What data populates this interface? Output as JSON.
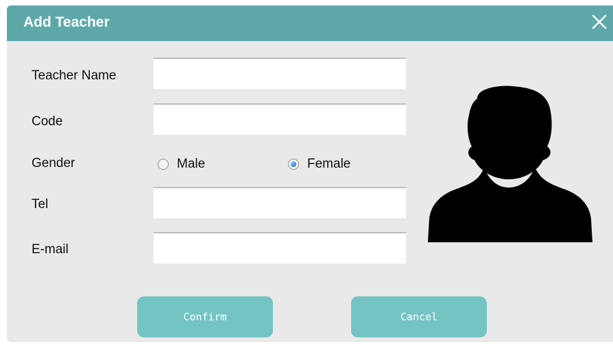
{
  "dialog": {
    "title": "Add Teacher",
    "accent_color": "#5ea8aa",
    "button_color": "#74c4c4"
  },
  "form": {
    "name_label": "Teacher Name",
    "name_value": "",
    "code_label": "Code",
    "code_value": "",
    "gender_label": "Gender",
    "gender_options": [
      "Male",
      "Female"
    ],
    "gender_selected": "Female",
    "tel_label": "Tel",
    "tel_value": "",
    "email_label": "E-mail",
    "email_value": ""
  },
  "icons": {
    "close": "close-icon",
    "avatar": "user-avatar-placeholder-icon"
  },
  "buttons": {
    "confirm_label": "Confirm",
    "cancel_label": "Cancel"
  }
}
